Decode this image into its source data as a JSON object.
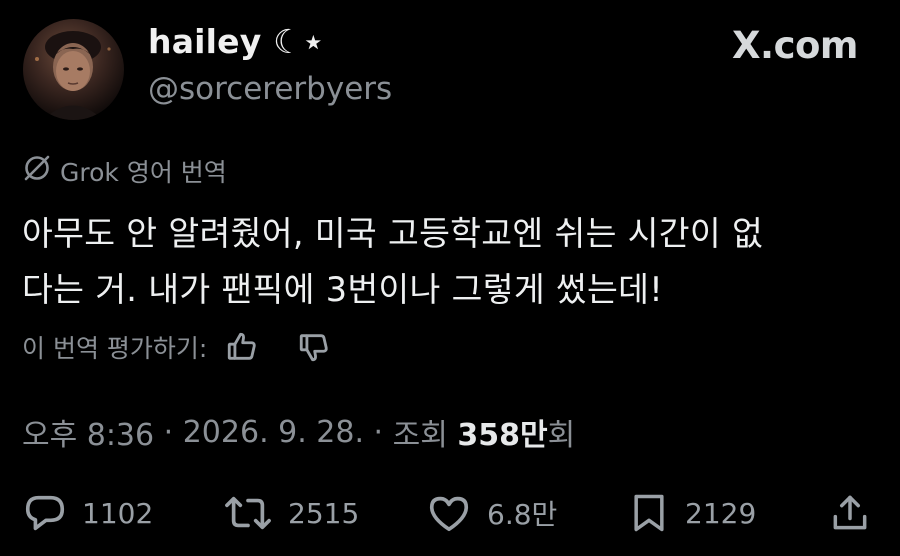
{
  "author": {
    "display_name": "hailey ☾⋆",
    "handle": "@sorcererbyers",
    "avatar_icon": "profile-photo"
  },
  "brand": "X.com",
  "translation": {
    "label": "Grok 영어 번역",
    "icon": "grok-slash-icon"
  },
  "tweet": {
    "line1": "아무도 안 알려줬어, 미국 고등학교엔 쉬는 시간이 없",
    "line2": "다는 거. 내가 팬픽에 3번이나 그렇게 썼는데!"
  },
  "rate": {
    "label": "이 번역 평가하기:",
    "like_icon": "thumbs-up-icon",
    "dislike_icon": "thumbs-down-icon"
  },
  "meta": {
    "time": "오후 8:36",
    "date": "2026. 9. 28.",
    "views_label": "조회",
    "views_count": "358만",
    "views_suffix": "회"
  },
  "actions": {
    "replies": "1102",
    "reposts": "2515",
    "likes": "6.8만",
    "bookmarks": "2129"
  },
  "colors": {
    "background": "#000000",
    "text": "#e7e9ea",
    "secondary": "#8b9096"
  }
}
